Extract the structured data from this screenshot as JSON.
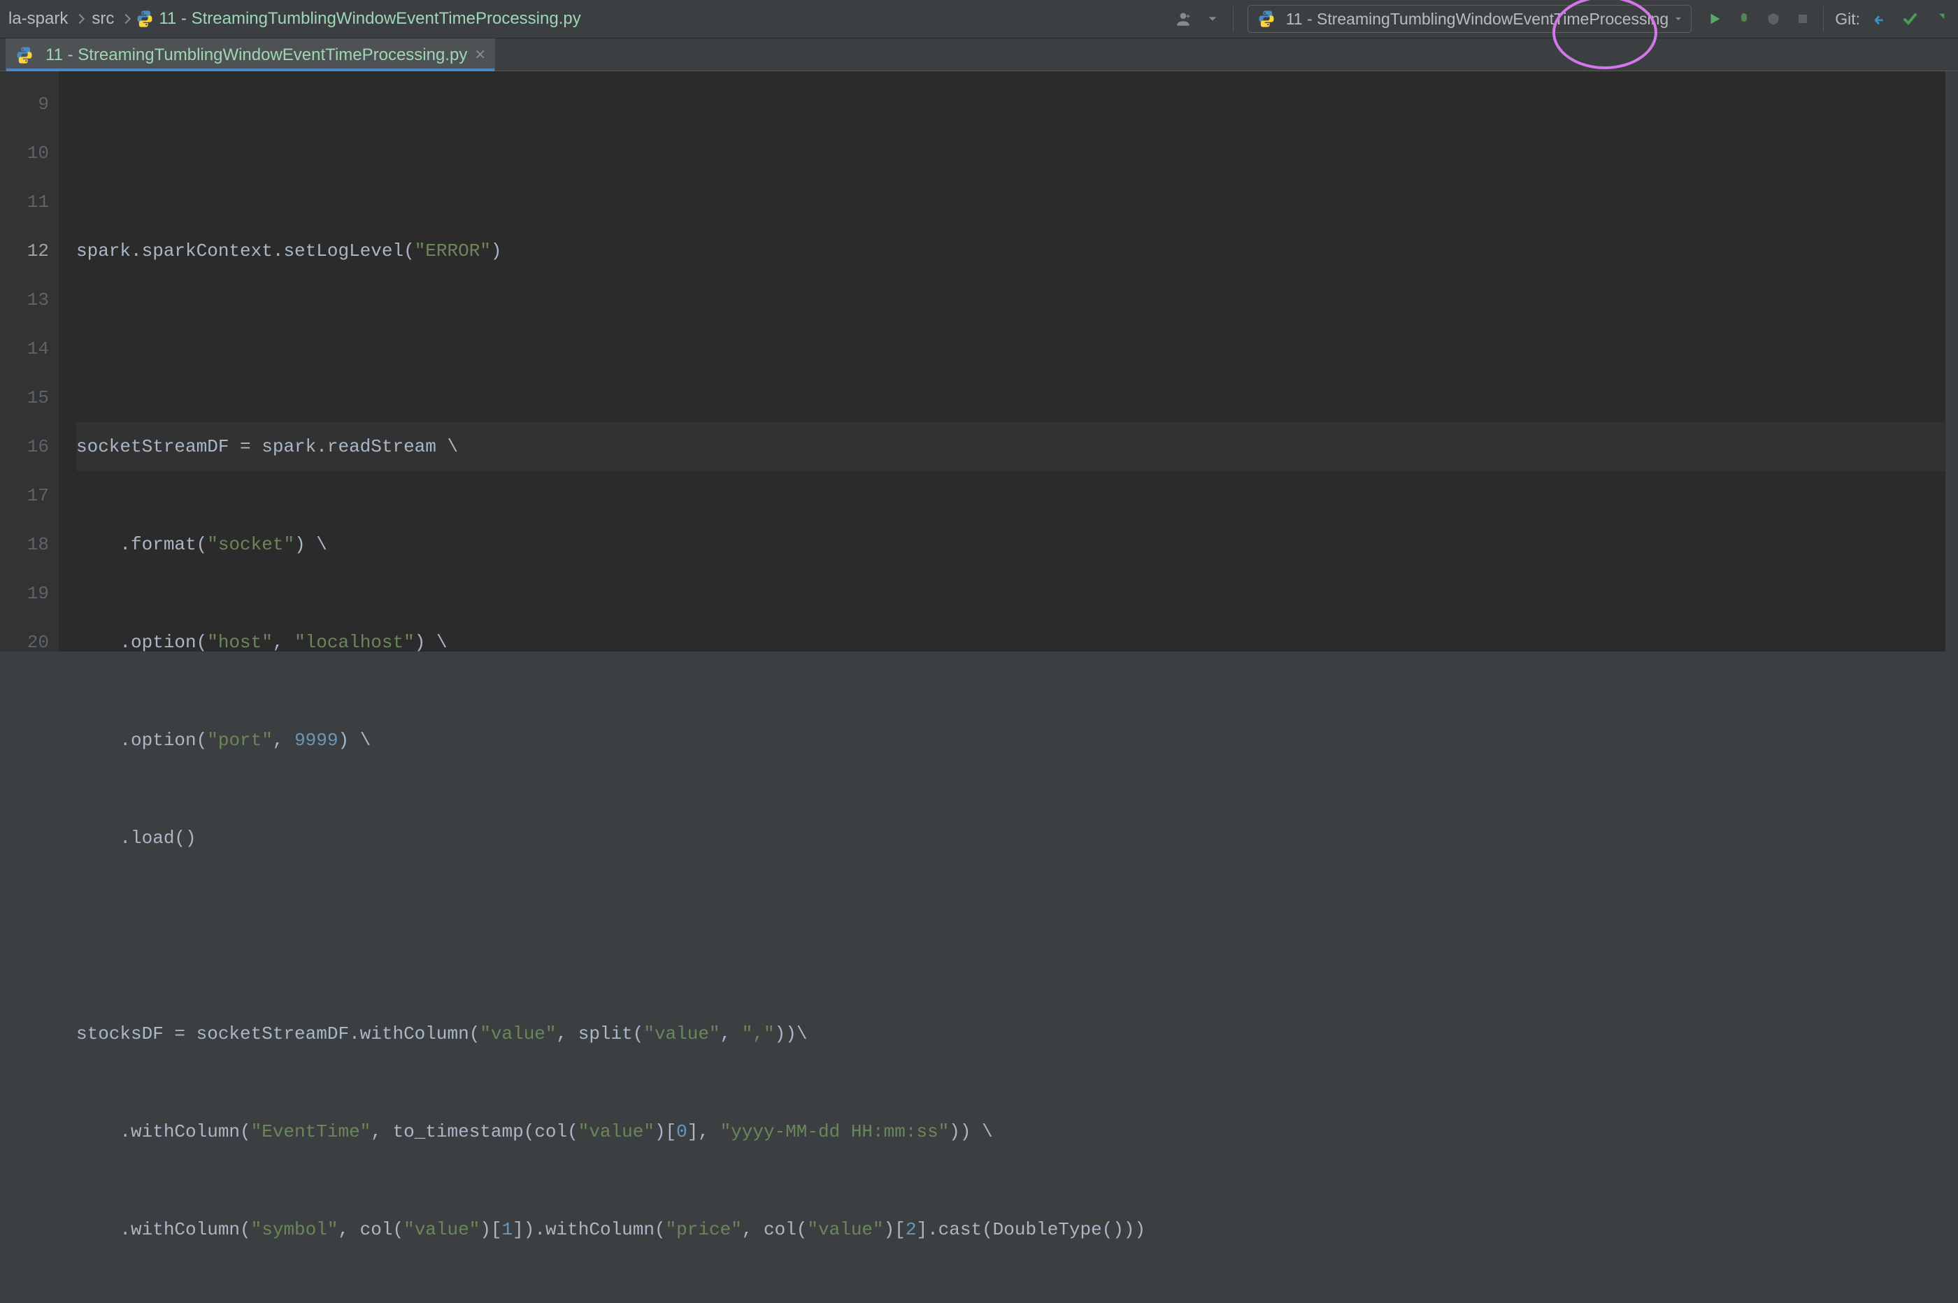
{
  "breadcrumbs": {
    "project": "la-spark",
    "folder": "src",
    "file": "11 - StreamingTumblingWindowEventTimeProcessing.py"
  },
  "run_config": {
    "label": "11 - StreamingTumblingWindowEventTimeProcessing"
  },
  "git_label": "Git:",
  "editor_tab": {
    "label": "11 - StreamingTumblingWindowEventTimeProcessing.py"
  },
  "gutter": [
    "9",
    "10",
    "11",
    "12",
    "13",
    "14",
    "15",
    "16",
    "17",
    "18",
    "19",
    "20"
  ],
  "code": {
    "l9": "",
    "l10": {
      "pre": "spark.sparkContext.setLogLevel(",
      "str": "\"ERROR\"",
      "post": ")"
    },
    "l11": "",
    "l12": {
      "a": "socketStreamDF = spark.readStream ",
      "bsl": "\\"
    },
    "l13": {
      "indent": "    .format(",
      "str": "\"socket\"",
      "post": ") ",
      "bsl": "\\"
    },
    "l14": {
      "indent": "    .option(",
      "s1": "\"host\"",
      "c": ", ",
      "s2": "\"localhost\"",
      "post": ") ",
      "bsl": "\\"
    },
    "l15": {
      "indent": "    .option(",
      "s1": "\"port\"",
      "c": ", ",
      "num": "9999",
      "post": ") ",
      "bsl": "\\"
    },
    "l16": {
      "indent": "    .load()"
    },
    "l17": "",
    "l18": {
      "a": "stocksDF = socketStreamDF.withColumn(",
      "s1": "\"value\"",
      "b": ", split(",
      "s2": "\"value\"",
      "c": ", ",
      "s3": "\",\"",
      "d": "))",
      "bsl": "\\"
    },
    "l19": {
      "indent": "    .withColumn(",
      "s1": "\"EventTime\"",
      "b": ", to_timestamp(col(",
      "s2": "\"value\"",
      "c": ")[",
      "n1": "0",
      "d": "], ",
      "s3": "\"yyyy-MM-dd HH:mm:ss\"",
      "e": ")) ",
      "bsl": "\\"
    },
    "l20": {
      "indent": "    .withColumn(",
      "s1": "\"symbol\"",
      "b": ", col(",
      "s2": "\"value\"",
      "c": ")[",
      "n1": "1",
      "d": "]).withColumn(",
      "s3": "\"price\"",
      "e": ", col(",
      "s4": "\"value\"",
      "f": ")[",
      "n2": "2",
      "g": "].cast(DoubleType()))"
    }
  }
}
